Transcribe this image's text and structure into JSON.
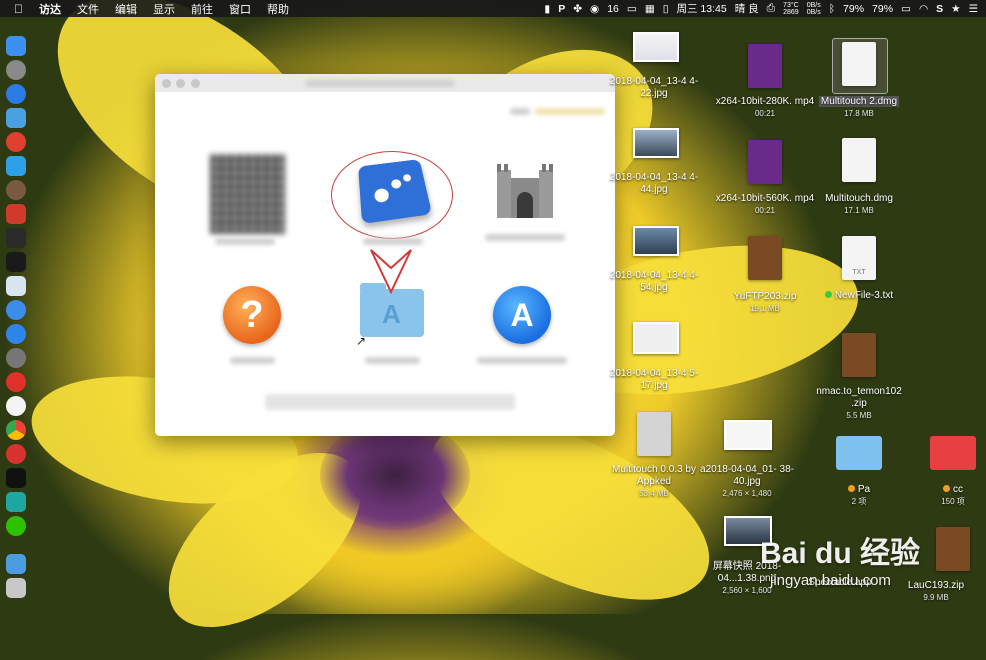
{
  "menubar": {
    "app": "访达",
    "menus": [
      "文件",
      "编辑",
      "显示",
      "前往",
      "窗口",
      "帮助"
    ],
    "wechat_count": "16",
    "temp": "73°C",
    "rpm": "2869",
    "net_up": "0B/s",
    "net_down": "0B/s",
    "battery1": "79%",
    "battery2": "79%",
    "clock": "周三 13:45",
    "weather": "晴 良"
  },
  "desktop": {
    "items": [
      {
        "label": "2018-04-04_13-4 4-22.jpg",
        "sub": ""
      },
      {
        "label": "x264-10bit-280K. mp4",
        "sub": "00:21"
      },
      {
        "label": "Multitouch 2.dmg",
        "sub": "17.8 MB"
      },
      {
        "label": "2018-04-04_13-4 4-44.jpg",
        "sub": ""
      },
      {
        "label": "x264-10bit-560K. mp4",
        "sub": "00:21"
      },
      {
        "label": "Multitouch.dmg",
        "sub": "17.1 MB"
      },
      {
        "label": "2018-04-04_13-4 4-54.jpg",
        "sub": ""
      },
      {
        "label": "YuFTP203.zip",
        "sub": "19.1 MB"
      },
      {
        "label": "NewFile-3.txt",
        "sub": ""
      },
      {
        "label": "2018-04-04_13-4 5-17.jpg",
        "sub": ""
      },
      {
        "label": "nmac.to_temon102 .zip",
        "sub": "5.5 MB"
      },
      {
        "label": "Multitouch 0.0.3 by Appked",
        "sub": "53.4 MB"
      },
      {
        "label": "a2018-04-04_01- 38-40.jpg",
        "sub": "2,476 × 1,480"
      },
      {
        "label": "Pa",
        "sub": "2 项"
      },
      {
        "label": "cc",
        "sub": "150 项"
      },
      {
        "label": "屏幕快照 2018-04...1.38.png",
        "sub": "2,560 × 1,600"
      },
      {
        "label": "Spectacle.app",
        "sub": ""
      },
      {
        "label": "LauC193.zip",
        "sub": "9.9 MB"
      }
    ],
    "txt_label": "TXT"
  },
  "watermark": {
    "brand": "Bai du 经验",
    "url": "jingyan.baidu.com"
  }
}
